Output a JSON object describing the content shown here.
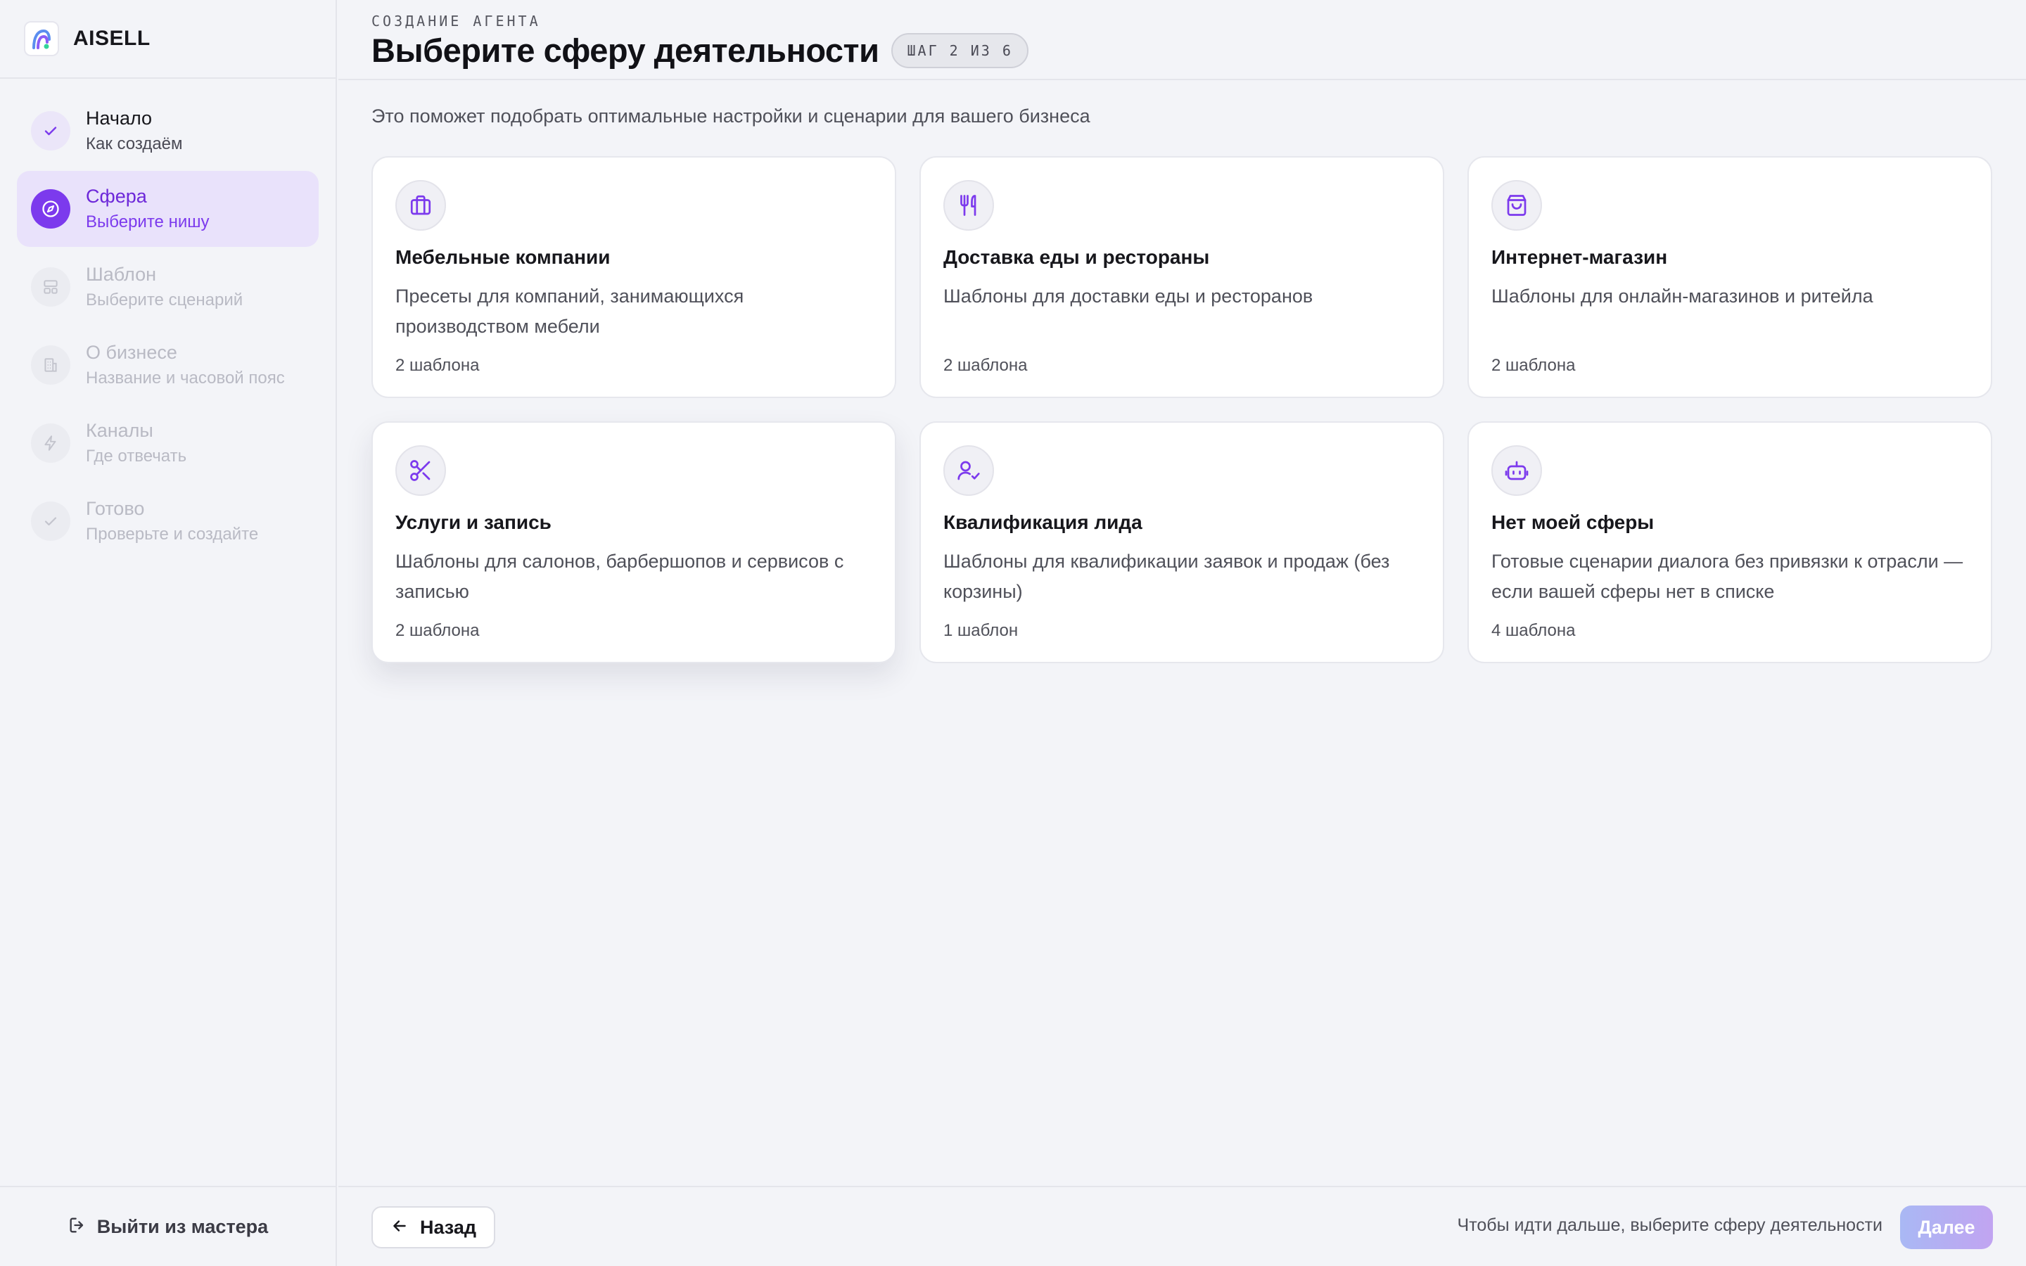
{
  "brand": {
    "name": "AISELL"
  },
  "sidebar": {
    "steps": [
      {
        "title": "Начало",
        "subtitle": "Как создаём",
        "state": "done",
        "icon": "check-icon"
      },
      {
        "title": "Сфера",
        "subtitle": "Выберите нишу",
        "state": "active",
        "icon": "compass-icon"
      },
      {
        "title": "Шаблон",
        "subtitle": "Выберите сценарий",
        "state": "pending",
        "icon": "layout-icon"
      },
      {
        "title": "О бизнесе",
        "subtitle": "Название и часовой пояс",
        "state": "pending",
        "icon": "building-icon"
      },
      {
        "title": "Каналы",
        "subtitle": "Где отвечать",
        "state": "pending",
        "icon": "bolt-icon"
      },
      {
        "title": "Готово",
        "subtitle": "Проверьте и создайте",
        "state": "pending",
        "icon": "check-icon"
      }
    ],
    "exit_label": "Выйти из мастера"
  },
  "header": {
    "eyebrow": "СОЗДАНИЕ АГЕНТА",
    "title": "Выберите сферу деятельности",
    "step_badge": "ШАГ 2 ИЗ 6"
  },
  "main": {
    "subtitle": "Это поможет подобрать оптимальные настройки и сценарии для вашего бизнеса",
    "cards": [
      {
        "title": "Мебельные компании",
        "description": "Пресеты для компаний, занимающихся производством мебели",
        "count": "2 шаблона",
        "icon": "briefcase-icon"
      },
      {
        "title": "Доставка еды и рестораны",
        "description": "Шаблоны для доставки еды и ресторанов",
        "count": "2 шаблона",
        "icon": "utensils-icon"
      },
      {
        "title": "Интернет-магазин",
        "description": "Шаблоны для онлайн-магазинов и ритейла",
        "count": "2 шаблона",
        "icon": "shopping-bag-icon"
      },
      {
        "title": "Услуги и запись",
        "description": "Шаблоны для салонов, барбершопов и сервисов с записью",
        "count": "2 шаблона",
        "icon": "scissors-icon"
      },
      {
        "title": "Квалификация лида",
        "description": "Шаблоны для квалификации заявок и продаж (без корзины)",
        "count": "1 шаблон",
        "icon": "user-check-icon"
      },
      {
        "title": "Нет моей сферы",
        "description": "Готовые сценарии диалога без привязки к отрасли — если вашей сферы нет в списке",
        "count": "4 шаблона",
        "icon": "bot-icon"
      }
    ]
  },
  "footer": {
    "back_label": "Назад",
    "hint": "Чтобы идти дальше, выберите сферу деятельности",
    "next_label": "Далее"
  },
  "colors": {
    "accent": "#7c3aed",
    "active_bg": "#e9e2fb",
    "background": "#f3f4f8"
  }
}
